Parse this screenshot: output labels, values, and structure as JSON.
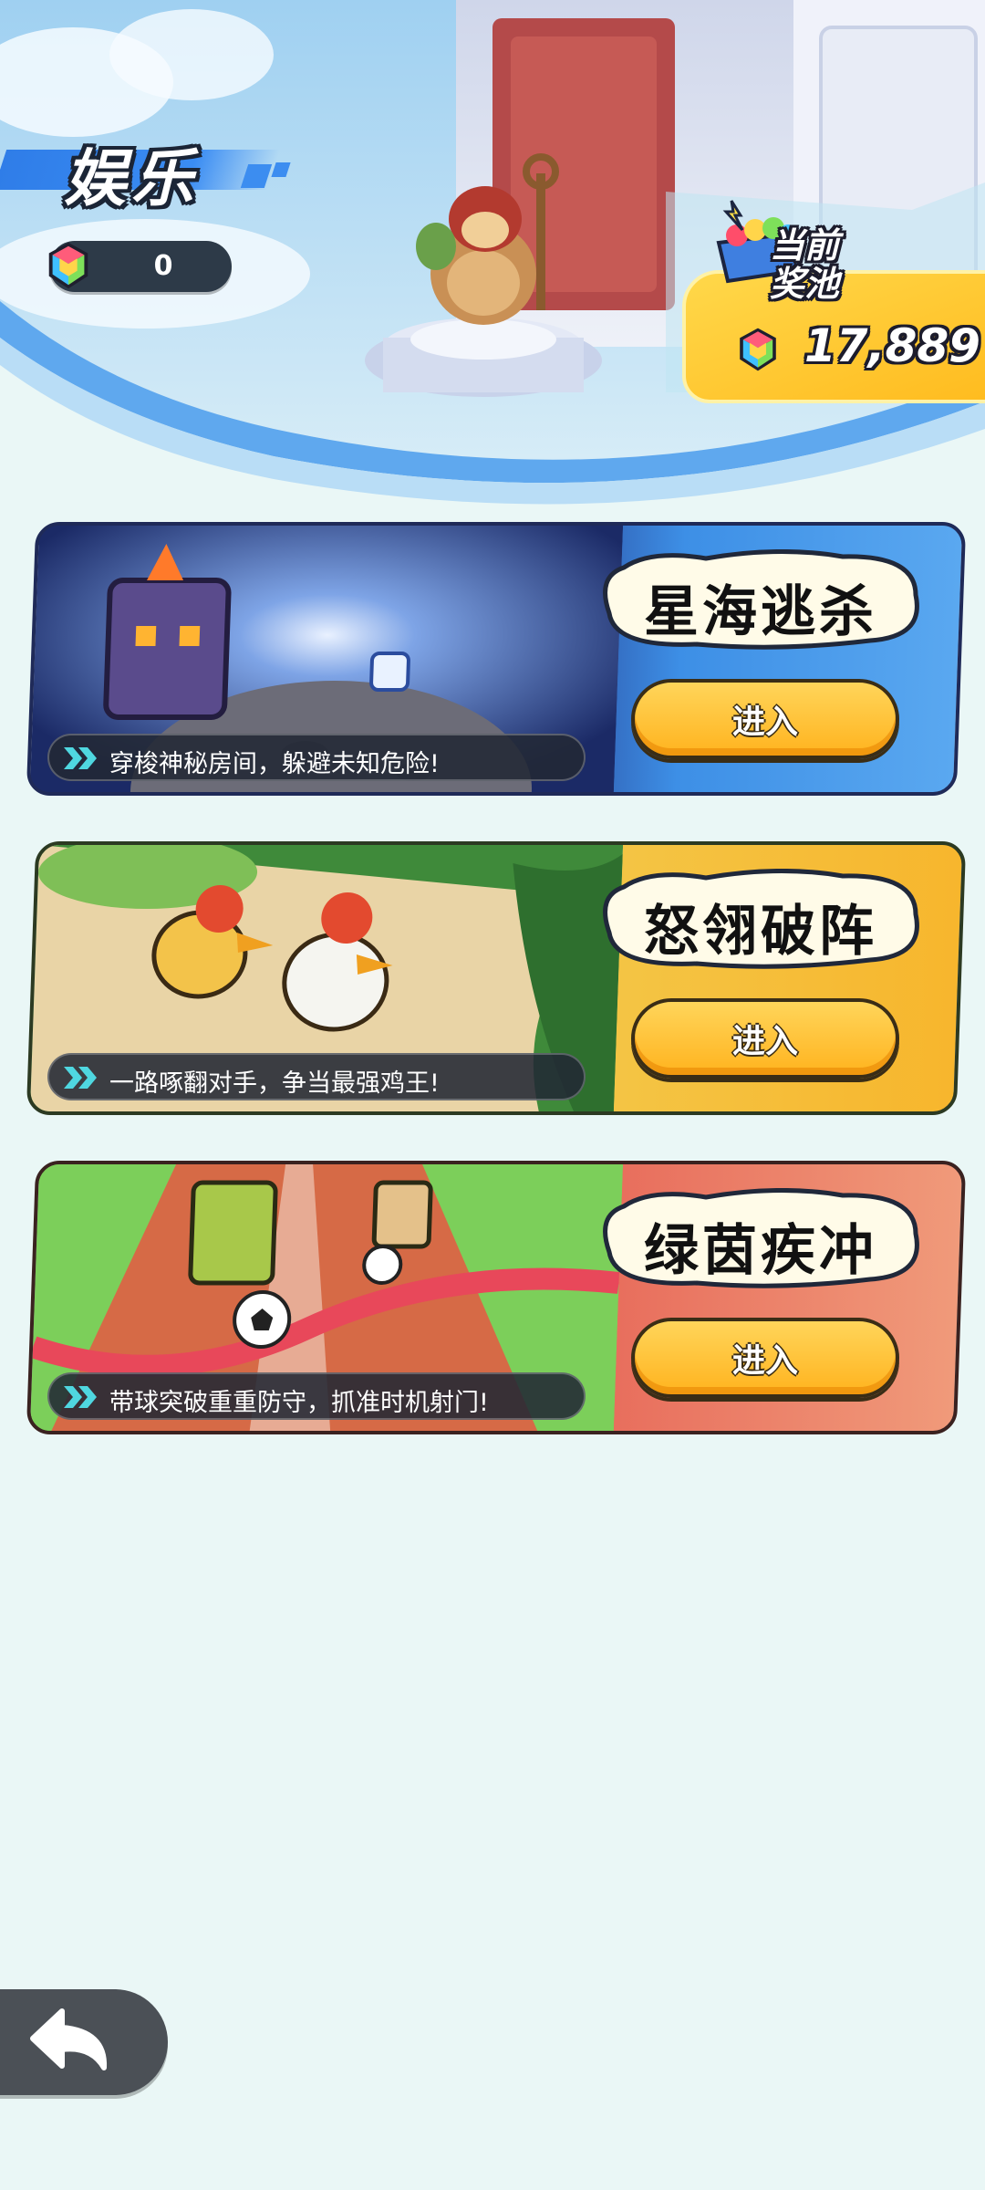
{
  "header": {
    "title": "娱乐",
    "gem_balance": "0",
    "jackpot": {
      "label_line1": "当前",
      "label_line2": "奖池",
      "amount": "17,889"
    }
  },
  "games": [
    {
      "name": "星海逃杀",
      "enter_label": "进入",
      "description": "穿梭神秘房间，躲避未知危险!",
      "theme_color": "#3a86e0"
    },
    {
      "name": "怒翎破阵",
      "enter_label": "进入",
      "description": "一路啄翻对手，争当最强鸡王!",
      "theme_color": "#f2b63a"
    },
    {
      "name": "绿茵疾冲",
      "enter_label": "进入",
      "description": "带球突破重重防守，抓准时机射门!",
      "theme_color": "#ec7a6a"
    }
  ],
  "icons": {
    "gem": "rainbow-gem-icon",
    "back": "back-arrow-icon",
    "chevron": "double-chevron-icon"
  },
  "colors": {
    "background": "#eaf7f6",
    "button_yellow": "#ffc234",
    "dark_outline": "#20283a"
  }
}
